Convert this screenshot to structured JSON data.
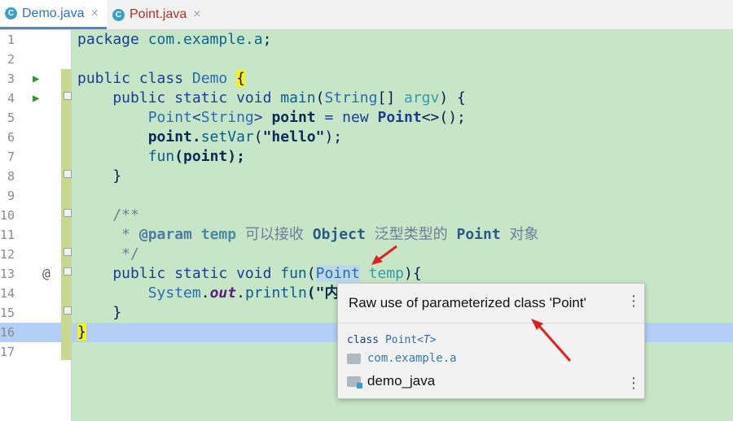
{
  "tabs": [
    {
      "label": "Demo.java",
      "icon": "java-class-icon",
      "active": true
    },
    {
      "label": "Point.java",
      "icon": "java-class-icon",
      "active": false
    }
  ],
  "line_numbers": [
    "1",
    "2",
    "3",
    "4",
    "5",
    "6",
    "7",
    "8",
    "9",
    "10",
    "11",
    "12",
    "13",
    "14",
    "15",
    "16",
    "17"
  ],
  "gutter_markers": {
    "run": "▶",
    "override": "@"
  },
  "tab_icon_letter": "C",
  "tab_close_glyph": "×",
  "code": {
    "l1": {
      "a": "package",
      "b": " com.example.a",
      "c": ";"
    },
    "l3": {
      "a": "public class ",
      "b": "Demo",
      "c": " ",
      "d": "{"
    },
    "l4": {
      "a": "    public static void ",
      "b": "main",
      "c": "(",
      "d": "String",
      "e": "[] ",
      "f": "argv",
      "g": ") {"
    },
    "l5": {
      "a": "        ",
      "b": "Point",
      "c": "<",
      "d": "String",
      "e": "> ",
      "f": "point",
      "g": " = new ",
      "h": "Point",
      "i": "<>();"
    },
    "l6": {
      "a": "        point.",
      "b": "setVar",
      "c": "(",
      "d": "\"hello\"",
      "e": ");"
    },
    "l7": {
      "a": "        ",
      "b": "fun",
      "c": "(point);"
    },
    "l8": {
      "a": "    }"
    },
    "l10": {
      "a": "    /**"
    },
    "l11": {
      "a": "     * ",
      "b": "@param",
      "c": " temp ",
      "d": "可以接收 ",
      "e": "Object",
      "f": " 泛型类型的 ",
      "g": "Point",
      "h": " 对象"
    },
    "l12": {
      "a": "     */"
    },
    "l13": {
      "a": "    public static void ",
      "b": "fun",
      "c": "(",
      "d": "Point",
      "e": " ",
      "f": "temp",
      "g": "){"
    },
    "l14": {
      "a": "        ",
      "b": "System",
      "c": ".",
      "d": "out",
      "e": ".",
      "f": "println",
      "g": "(\"内"
    },
    "l15": {
      "a": "    }"
    },
    "l16": {
      "a": "}"
    }
  },
  "popup": {
    "message": "Raw use of parameterized class 'Point'",
    "class_kw": "class ",
    "class_name": "Point",
    "type_param": "<T>",
    "package": "com.example.a",
    "module": "demo_java",
    "more": "⋮"
  },
  "colors": {
    "editor_bg": "#c7e6c7",
    "current_line": "#b3cff5",
    "annotation_arrow": "#e02020"
  }
}
